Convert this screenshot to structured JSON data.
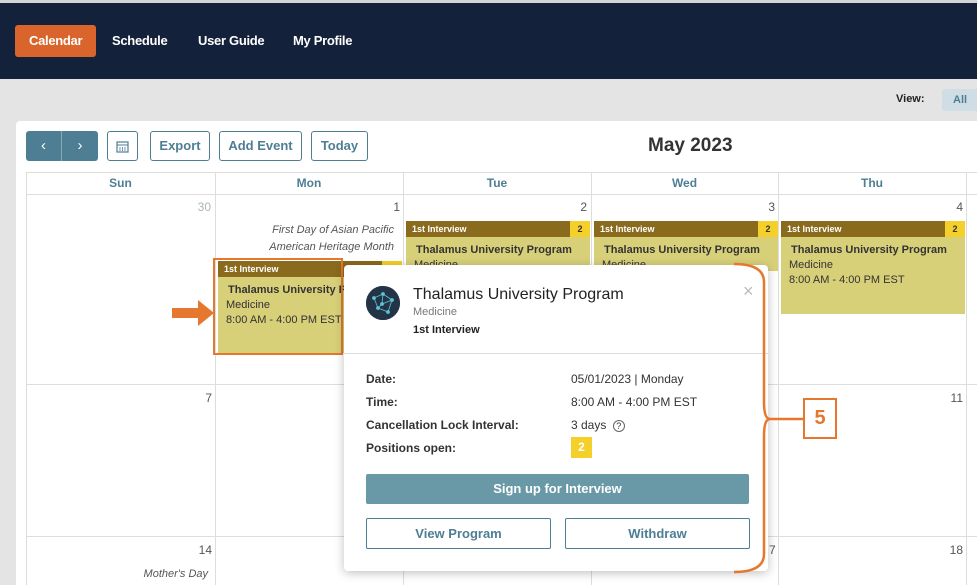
{
  "nav": {
    "items": [
      {
        "label": "Calendar",
        "active": true
      },
      {
        "label": "Schedule"
      },
      {
        "label": "User Guide"
      },
      {
        "label": "My Profile"
      }
    ]
  },
  "view": {
    "label": "View:",
    "selected": "All"
  },
  "toolbar": {
    "prev_icon": "‹",
    "next_icon": "›",
    "calendar_icon": "calendar-icon",
    "export_label": "Export",
    "add_event_label": "Add Event",
    "today_label": "Today",
    "month_title": "May 2023"
  },
  "weekdays": [
    "Sun",
    "Mon",
    "Tue",
    "Wed",
    "Thu"
  ],
  "days": {
    "r1": [
      "30",
      "1",
      "2",
      "3",
      "4"
    ],
    "r2": [
      "7",
      "11"
    ],
    "r3": [
      "14",
      "18"
    ],
    "r2_partial": "0",
    "r3_partial": "7"
  },
  "holidays": {
    "mon1": [
      "First Day of Asian Pacific",
      "American Heritage Month"
    ],
    "sun3": "Mother's Day"
  },
  "events": [
    {
      "head": "1st Interview",
      "count": "2",
      "title": "Thalamus University Program",
      "dept": "Medicine",
      "time": "8:00 AM - 4:00 PM EST"
    },
    {
      "head": "1st Interview",
      "count": "2",
      "title": "Thalamus University Program",
      "dept": "Medicine",
      "time": "8:00 AM - 4:00 PM EST"
    },
    {
      "head": "1st Interview",
      "count": "2",
      "title": "Thalamus University Program",
      "dept": "Medicine",
      "time": "8:00 AM - 4:00 PM EST"
    },
    {
      "head": "1st Interview",
      "count": "2",
      "title": "Thalamus University Program",
      "dept": "Medicine",
      "time": "8:00 AM - 4:00 PM EST"
    }
  ],
  "popup": {
    "title": "Thalamus University Program",
    "subtitle": "Medicine",
    "type": "1st Interview",
    "close_icon": "×",
    "fields": [
      {
        "label": "Date:",
        "value": "05/01/2023 | Monday"
      },
      {
        "label": "Time:",
        "value": "8:00 AM - 4:00 PM EST"
      },
      {
        "label": "Cancellation Lock Interval:",
        "value": "3 days"
      },
      {
        "label": "Positions open:",
        "value": "2"
      }
    ],
    "help_icon": "?",
    "signup_label": "Sign up for Interview",
    "view_program_label": "View Program",
    "withdraw_label": "Withdraw"
  },
  "annotation": {
    "step": "5"
  },
  "colors": {
    "nav_bg": "#14213a",
    "accent": "#d9652c",
    "teal": "#4e7e94",
    "event_bg": "#d8d079",
    "event_head": "#8a6a1c",
    "badge": "#f5d02b"
  }
}
